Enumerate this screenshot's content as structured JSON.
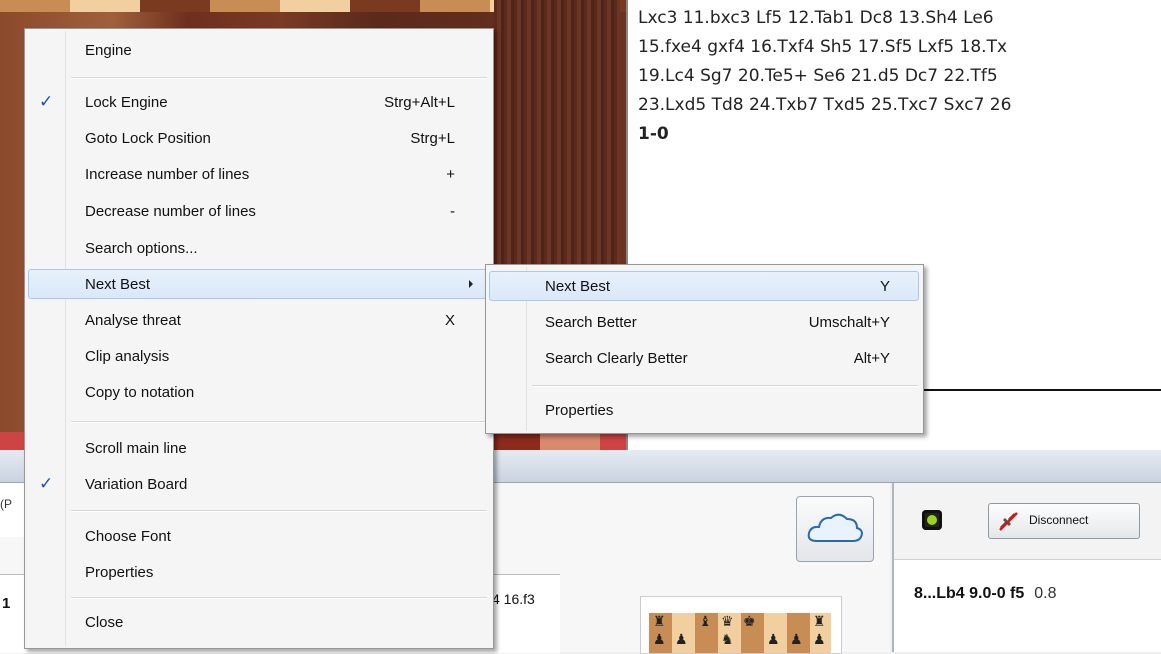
{
  "notation": {
    "lines": [
      "Lxc3 11.bxc3 Lf5 12.Tab1 Dc8 13.Sh4 Le6",
      "15.fxe4 gxf4 16.Txf4 Sh5 17.Sf5 Lxf5 18.Tx",
      "19.Lc4 Sg7 20.Te5+ Se6 21.d5 Dc7 22.Tf5",
      "23.Lxd5 Td8 24.Txb7 Txd5 25.Txc7 Sxc7 26"
    ],
    "result": "1-0"
  },
  "lower": {
    "tab_fragment": "(P",
    "move_fragment_left": "1",
    "move_fragment_right": "4 16.f3"
  },
  "engine": {
    "disconnect_label": "Disconnect",
    "line_move": "8...Lb4 9.0-0 f5",
    "line_score": "0.8"
  },
  "context_menu": {
    "header": "Engine",
    "lock_engine": {
      "label": "Lock Engine",
      "shortcut": "Strg+Alt+L",
      "checked": true
    },
    "goto_lock": {
      "label": "Goto Lock Position",
      "shortcut": "Strg+L"
    },
    "increase_lines": {
      "label": "Increase number of lines",
      "shortcut": "+"
    },
    "decrease_lines": {
      "label": "Decrease number of lines",
      "shortcut": "-"
    },
    "search_options": {
      "label": "Search options..."
    },
    "next_best": {
      "label": "Next Best"
    },
    "analyse_threat": {
      "label": "Analyse threat",
      "shortcut": "X"
    },
    "clip_analysis": {
      "label": "Clip analysis"
    },
    "copy_notation": {
      "label": "Copy to notation"
    },
    "scroll_main": {
      "label": "Scroll main line"
    },
    "variation_board": {
      "label": "Variation Board",
      "checked": true
    },
    "choose_font": {
      "label": "Choose Font"
    },
    "properties": {
      "label": "Properties"
    },
    "close": {
      "label": "Close"
    }
  },
  "submenu": {
    "next_best": {
      "label": "Next Best",
      "shortcut": "Y"
    },
    "search_better": {
      "label": "Search Better",
      "shortcut": "Umschalt+Y"
    },
    "search_clearly_better": {
      "label": "Search Clearly Better",
      "shortcut": "Alt+Y"
    },
    "properties": {
      "label": "Properties"
    }
  },
  "icons": {
    "checkmark": "✓",
    "cloud": "cloud-icon",
    "disconnect": "disconnect-icon"
  }
}
